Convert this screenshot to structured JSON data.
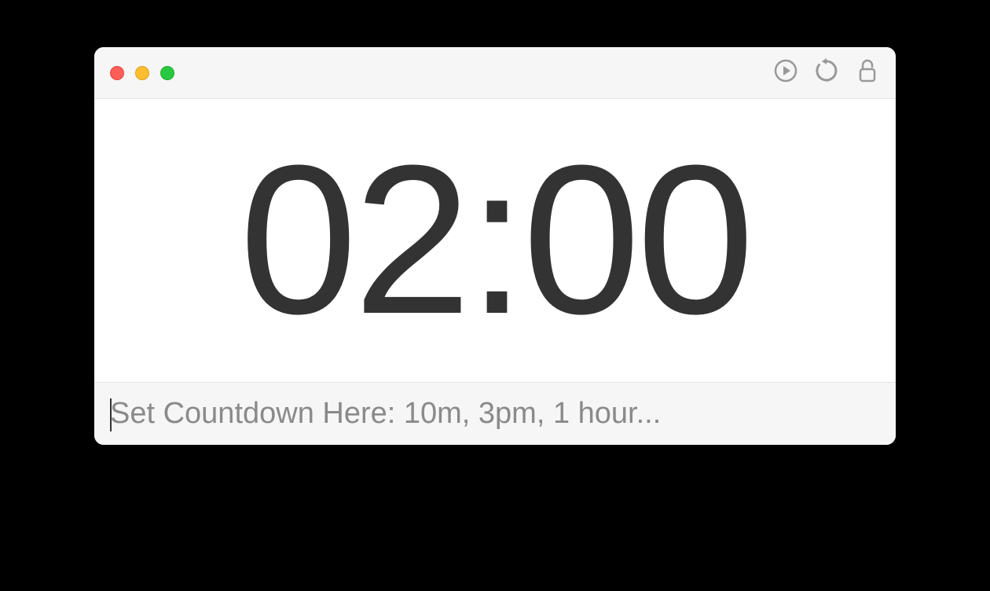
{
  "timer": {
    "display": "02:00"
  },
  "input": {
    "placeholder": "Set Countdown Here: 10m, 3pm, 1 hour...",
    "value": ""
  }
}
